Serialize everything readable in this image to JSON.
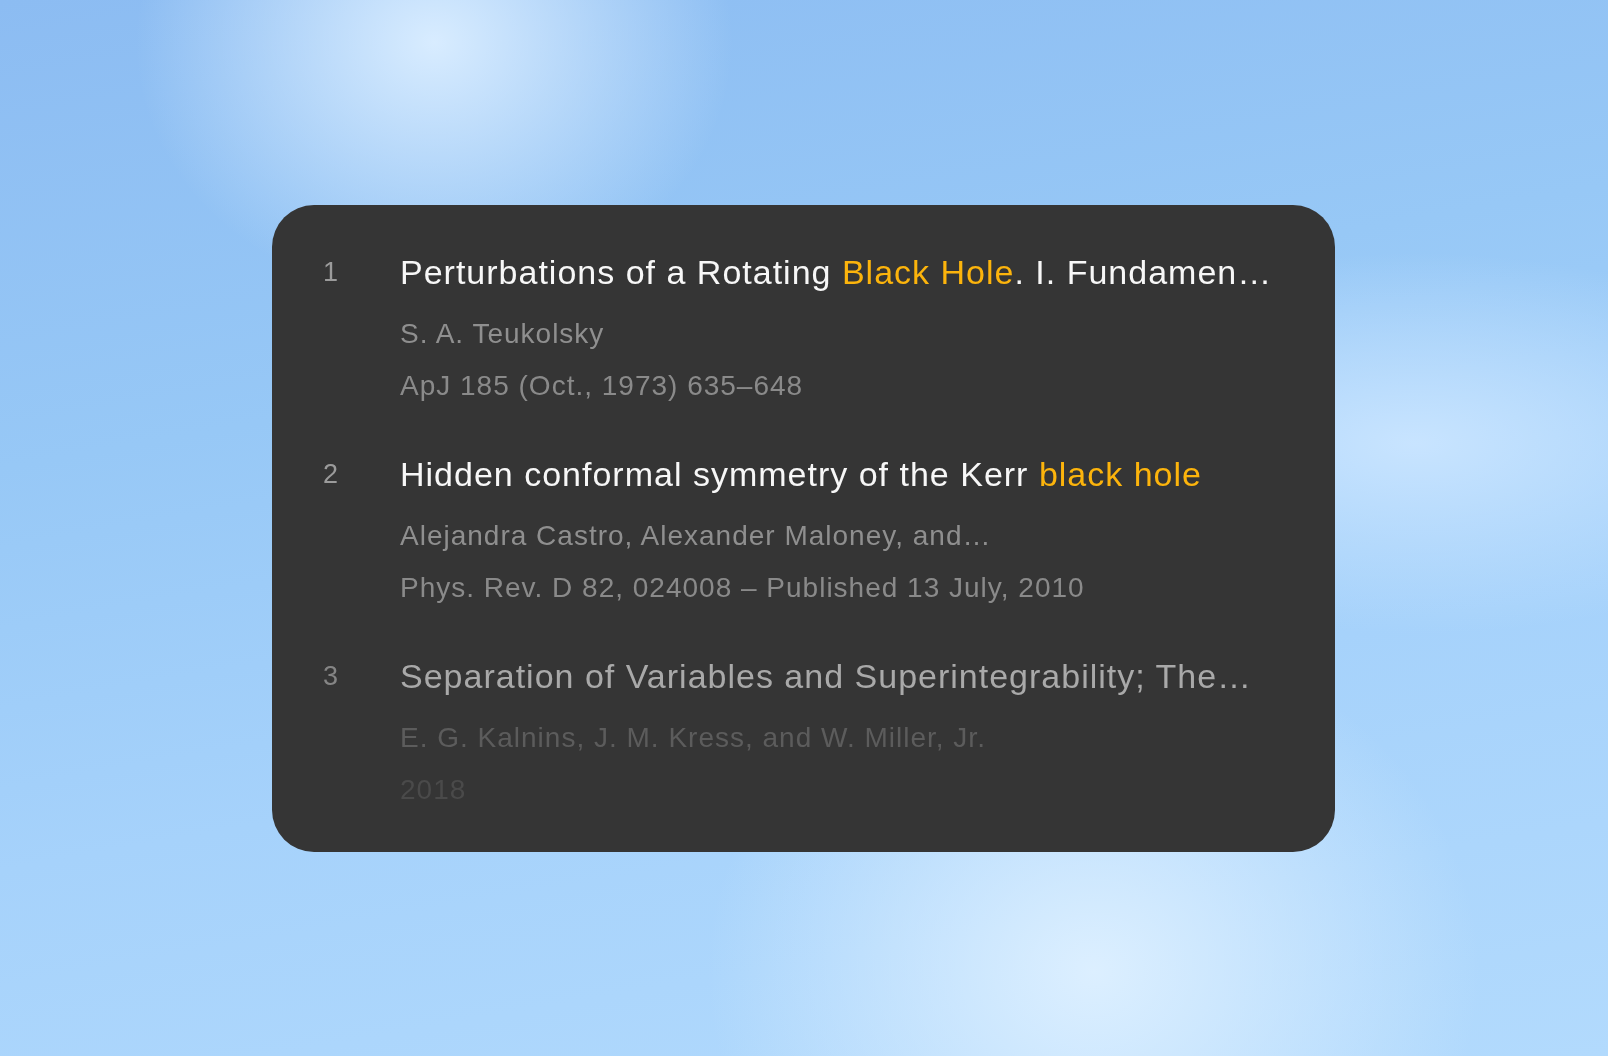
{
  "results": [
    {
      "number": "1",
      "faded": false,
      "title": [
        {
          "text": "Perturbations of a Rotating ",
          "highlight": false
        },
        {
          "text": "Black Hole",
          "highlight": true
        },
        {
          "text": ". I. Fundamen…",
          "highlight": false
        }
      ],
      "authors": "S. A. Teukolsky",
      "source": "ApJ 185 (Oct., 1973) 635–648"
    },
    {
      "number": "2",
      "faded": false,
      "title": [
        {
          "text": "Hidden conformal symmetry of the Kerr ",
          "highlight": false
        },
        {
          "text": "black hole",
          "highlight": true
        }
      ],
      "authors": "Alejandra Castro, Alexander Maloney, and…",
      "source": "Phys. Rev. D 82, 024008 – Published 13 July, 2010"
    },
    {
      "number": "3",
      "faded": true,
      "title": [
        {
          "text": "Separation of Variables and Superintegrability; The…",
          "highlight": false
        }
      ],
      "authors": "E. G. Kalnins, J. M. Kress, and W. Miller, Jr.",
      "source": "2018"
    }
  ]
}
